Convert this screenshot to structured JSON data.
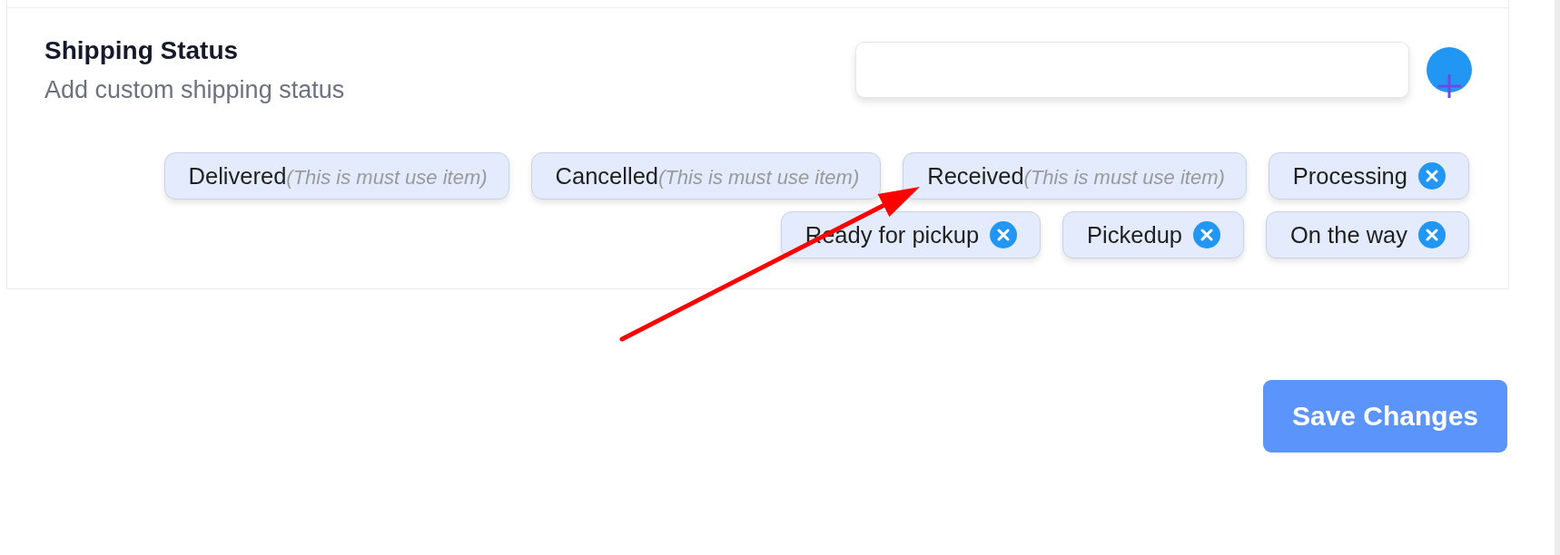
{
  "section": {
    "title": "Shipping Status",
    "subtitle": "Add custom shipping status"
  },
  "statuses": [
    {
      "label": "Delivered",
      "kind": "required",
      "note": "(This is must use item)"
    },
    {
      "label": "Cancelled",
      "kind": "required",
      "note": "(This is must use item)"
    },
    {
      "label": "Received",
      "kind": "required",
      "note": "(This is must use item)"
    },
    {
      "label": "Processing",
      "kind": "removable"
    },
    {
      "label": "Ready for pickup",
      "kind": "removable"
    },
    {
      "label": "Pickedup",
      "kind": "removable"
    },
    {
      "label": "On the way",
      "kind": "removable"
    }
  ],
  "save_button": "Save Changes",
  "annotations": [
    {
      "kind": "arrow"
    }
  ]
}
